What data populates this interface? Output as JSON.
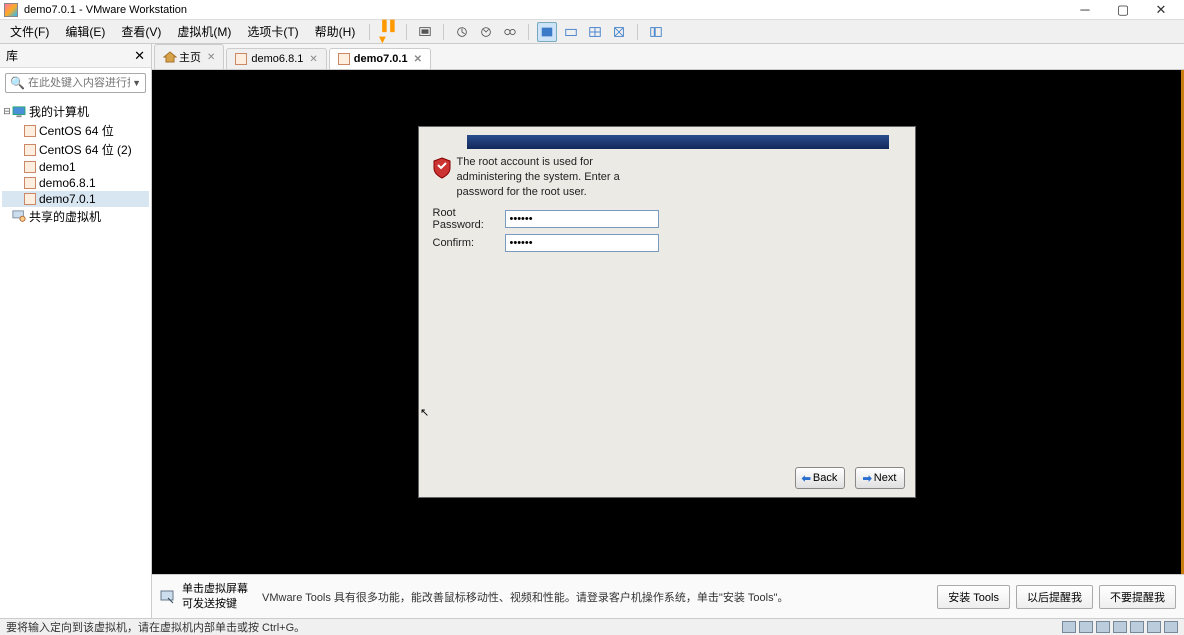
{
  "window": {
    "title": "demo7.0.1 - VMware Workstation"
  },
  "menu": {
    "file": "文件(F)",
    "edit": "编辑(E)",
    "view": "查看(V)",
    "vm": "虚拟机(M)",
    "tabs": "选项卡(T)",
    "help": "帮助(H)"
  },
  "sidebar": {
    "title": "库",
    "search_placeholder": "在此处键入内容进行搜...",
    "root": "我的计算机",
    "items": [
      "CentOS 64 位",
      "CentOS 64 位 (2)",
      "demo1",
      "demo6.8.1",
      "demo7.0.1"
    ],
    "shared": "共享的虚拟机"
  },
  "tabs": {
    "home": "主页",
    "t1": "demo6.8.1",
    "t2": "demo7.0.1"
  },
  "installer": {
    "message": "The root account is used for administering the system.  Enter a password for the root user.",
    "root_label": "Root Password:",
    "confirm_label": "Confirm:",
    "root_value": "••••••",
    "confirm_value": "••••••",
    "back": "Back",
    "next": "Next"
  },
  "footer": {
    "tip_line1": "单击虚拟屏幕",
    "tip_line2": "可发送按键",
    "tools_msg": "VMware Tools 具有很多功能，能改善鼠标移动性、视频和性能。请登录客户机操作系统，单击\"安装 Tools\"。",
    "install": "安装 Tools",
    "remind": "以后提醒我",
    "noremind": "不要提醒我"
  },
  "status": {
    "text": "要将输入定向到该虚拟机，请在虚拟机内部单击或按 Ctrl+G。"
  }
}
